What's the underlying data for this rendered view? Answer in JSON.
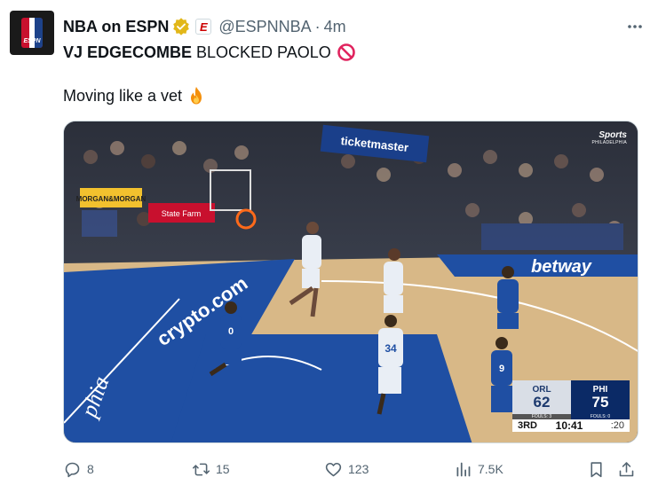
{
  "author": {
    "display_name": "NBA on ESPN",
    "handle": "@ESPNNBA",
    "separator": "·",
    "timestamp": "4m",
    "avatar_text": "ESPN",
    "affiliate_badge": "E"
  },
  "tweet": {
    "line1_bold": "VJ EDGECOMBE",
    "line1_rest": "BLOCKED PAOLO",
    "line2": "Moving like a vet"
  },
  "media": {
    "broadcaster_line1": "Sports",
    "broadcaster_line2": "PHILADELPHIA",
    "scorebug": {
      "team1": "ORL",
      "score1": "62",
      "fouls1": "FOULS: 3",
      "team2": "PHI",
      "score2": "75",
      "fouls2": "FOULS: 0",
      "period": "3RD",
      "clock": "10:41",
      "shot_clock": ":20"
    }
  },
  "actions": {
    "replies": "8",
    "retweets": "15",
    "likes": "123",
    "views": "7.5K"
  },
  "colors": {
    "text": "#0f1419",
    "muted": "#536471",
    "verified_gold": "#e2b719",
    "espn_red": "#cc0000",
    "court_blue": "#1f4fa3"
  }
}
